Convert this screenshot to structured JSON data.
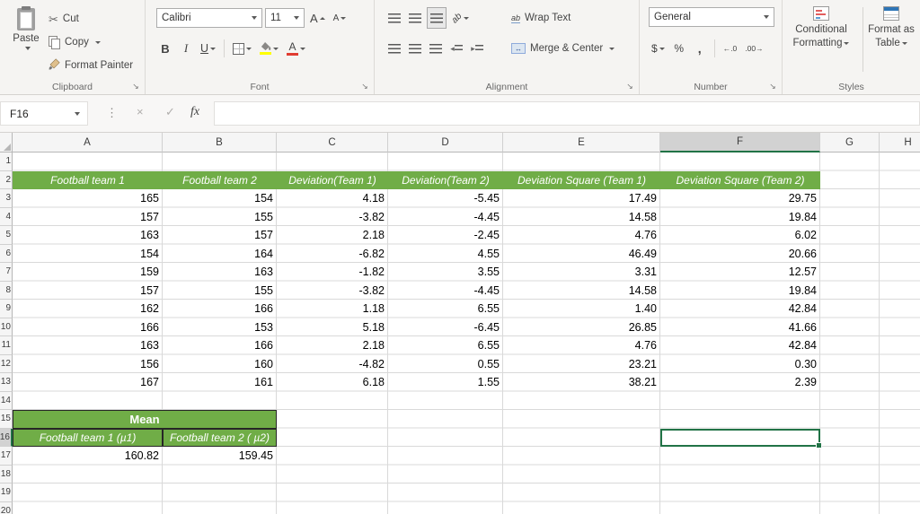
{
  "colors": {
    "header_green": "#70AD47",
    "selection_green": "#217346",
    "highlight_yellow": "#FFFF00",
    "font_color_red": "#E03C31"
  },
  "icons": {
    "scissors": "✂",
    "cancel": "×",
    "enter": "✓",
    "fx": "fx",
    "separator_dots": "⋮",
    "launcher": "↘",
    "wrap_ab": "ab",
    "orient_ab": "ab",
    "merge_arrows": "↔",
    "indent_left": "◂",
    "indent_right": "▸"
  },
  "ribbon": {
    "clipboard": {
      "label": "Clipboard",
      "paste": "Paste",
      "cut": "Cut",
      "copy": "Copy",
      "format_painter": "Format Painter"
    },
    "font": {
      "label": "Font",
      "font_name": "Calibri",
      "font_size": "11",
      "bold": "B",
      "italic": "I",
      "underline": "U",
      "grow": "A",
      "shrink": "A",
      "font_color_letter": "A"
    },
    "alignment": {
      "label": "Alignment",
      "wrap_text": "Wrap Text",
      "merge_center": "Merge & Center"
    },
    "number": {
      "label": "Number",
      "format": "General",
      "currency": "$",
      "percent": "%",
      "comma": ",",
      "inc_decimal": "←.0",
      "dec_decimal": ".00→"
    },
    "styles": {
      "label": "Styles",
      "cf_line1": "Conditional",
      "cf_line2": "Formatting",
      "ft_line1": "Format as",
      "ft_line2": "Table"
    }
  },
  "formula_bar": {
    "name_box": "F16",
    "formula_value": ""
  },
  "sheet": {
    "col_headers": [
      "A",
      "B",
      "C",
      "D",
      "E",
      "F",
      "G",
      "H"
    ],
    "row_numbers": [
      "1",
      "2",
      "3",
      "4",
      "5",
      "6",
      "7",
      "8",
      "9",
      "10",
      "11",
      "12",
      "13",
      "14",
      "15",
      "16",
      "17",
      "18",
      "19",
      "20"
    ],
    "selection": {
      "cell": "F16",
      "column": "F",
      "row": "16"
    },
    "table": {
      "headers": [
        "Football team 1",
        "Football team 2",
        "Deviation(Team 1)",
        "Deviation(Team 2)",
        "Deviation Square (Team 1)",
        "Deviation Square (Team 2)"
      ],
      "rows": [
        [
          "165",
          "154",
          "4.18",
          "-5.45",
          "17.49",
          "29.75"
        ],
        [
          "157",
          "155",
          "-3.82",
          "-4.45",
          "14.58",
          "19.84"
        ],
        [
          "163",
          "157",
          "2.18",
          "-2.45",
          "4.76",
          "6.02"
        ],
        [
          "154",
          "164",
          "-6.82",
          "4.55",
          "46.49",
          "20.66"
        ],
        [
          "159",
          "163",
          "-1.82",
          "3.55",
          "3.31",
          "12.57"
        ],
        [
          "157",
          "155",
          "-3.82",
          "-4.45",
          "14.58",
          "19.84"
        ],
        [
          "162",
          "166",
          "1.18",
          "6.55",
          "1.40",
          "42.84"
        ],
        [
          "166",
          "153",
          "5.18",
          "-6.45",
          "26.85",
          "41.66"
        ],
        [
          "163",
          "166",
          "2.18",
          "6.55",
          "4.76",
          "42.84"
        ],
        [
          "156",
          "160",
          "-4.82",
          "0.55",
          "23.21",
          "0.30"
        ],
        [
          "167",
          "161",
          "6.18",
          "1.55",
          "38.21",
          "2.39"
        ]
      ]
    },
    "mean": {
      "title": "Mean",
      "headers": [
        "Football team 1 (µ1)",
        "Football team 2 ( µ2)"
      ],
      "values": [
        "160.82",
        "159.45"
      ]
    }
  }
}
